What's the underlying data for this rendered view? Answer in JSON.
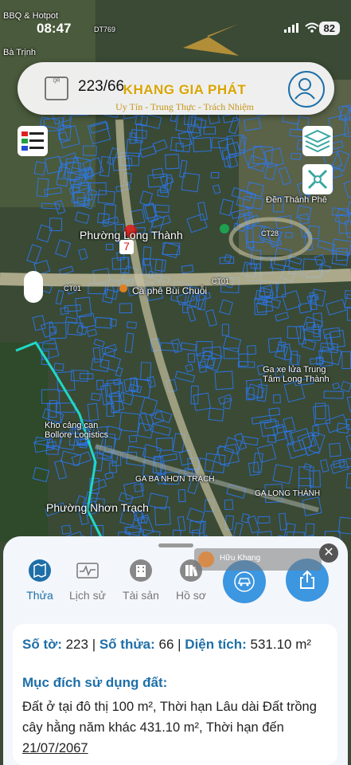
{
  "status_bar": {
    "time": "08:47",
    "battery": "82"
  },
  "search": {
    "value": "223/66",
    "qr_label": "QR"
  },
  "brand": {
    "name": "KHANG GIA PHÁT",
    "slogan": "Uy Tín - Trung Thực - Trách Nhiệm"
  },
  "map_labels": {
    "ward_long_thanh": "Phường Long Thành",
    "ward_nhon_trach": "Phường Nhơn Trạch",
    "parcel_marker": "7",
    "cafe": "Cà phê Bùi Chuỗi",
    "temple": "Đền Thánh Phê",
    "port": "Kho cảng cạn Bollore Logistics",
    "road_ct01_a": "CT01",
    "road_ct01_b": "CT01",
    "road_ct28": "CT28",
    "road_dt769": "DT769",
    "bbq": "BBQ & Hotpot",
    "ba_trinh": "Bà Trịnh",
    "ga_nhon_trach": "GA BA NHƠN TRẠCH",
    "ga_long_thanh": "GA LONG THÀNH",
    "gas_station": "Ga xe lửa Trung Tâm Long Thành"
  },
  "tabs": [
    {
      "label": "Thửa",
      "icon": "map-icon",
      "active": true
    },
    {
      "label": "Lịch sử",
      "icon": "chart-icon",
      "active": false
    },
    {
      "label": "Tài sản",
      "icon": "building-icon",
      "active": false
    },
    {
      "label": "Hồ sơ",
      "icon": "books-icon",
      "active": false
    }
  ],
  "chat_bubble": {
    "name": "Hữu Khang"
  },
  "parcel": {
    "so_to_label": "Số tờ:",
    "so_to": "223",
    "so_thua_label": "Số thửa:",
    "so_thua": "66",
    "dien_tich_label": "Diện tích:",
    "dien_tich": "531.10 m²",
    "muc_dich_label": "Mục đích sử dụng đất:",
    "muc_dich_text": "Đất ở tại đô thị 100 m², Thời hạn Lâu dài Đất trồng cây hằng năm khác 431.10 m², Thời hạn đến",
    "han_den": "21/07/2067"
  },
  "colors": {
    "accent": "#1e6fa8",
    "fab": "#3c96e0",
    "parcel_lines": "#2a7bff",
    "brand": "#d9a400"
  }
}
